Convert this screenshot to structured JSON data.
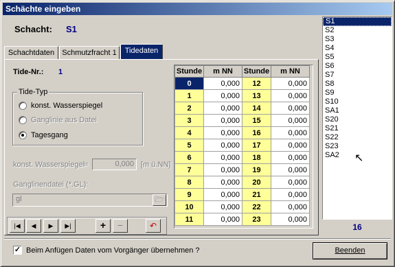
{
  "window": {
    "title": "Schächte eingeben"
  },
  "header": {
    "schacht_label": "Schacht:",
    "schacht_value": "S1"
  },
  "tabs": [
    {
      "label": "Schachtdaten",
      "active": false
    },
    {
      "label": "Schmutzfracht 1",
      "active": false
    },
    {
      "label": "Tidedaten",
      "active": true
    }
  ],
  "tide": {
    "nr_label": "Tide-Nr.:",
    "nr_value": "1",
    "type_group_title": "Tide-Typ",
    "options": [
      {
        "label": "konst. Wasserspiegel",
        "checked": false,
        "enabled": true
      },
      {
        "label": "Ganglinie aus Datei",
        "checked": false,
        "enabled": false
      },
      {
        "label": "Tagesgang",
        "checked": true,
        "enabled": true
      }
    ],
    "konst_label": "konst. Wasserspiegel",
    "konst_eq": "=",
    "konst_value": "0,000",
    "konst_unit": "[m ü.NN]",
    "gl_label": "Ganglinendatei (*.GL):",
    "gl_value": "gl"
  },
  "grid": {
    "columns": [
      "Stunde",
      "m NN",
      "Stunde",
      "m NN"
    ],
    "rows": [
      {
        "h1": "0",
        "v1": "0,000",
        "h2": "12",
        "v2": "0,000"
      },
      {
        "h1": "1",
        "v1": "0,000",
        "h2": "13",
        "v2": "0,000"
      },
      {
        "h1": "2",
        "v1": "0,000",
        "h2": "14",
        "v2": "0,000"
      },
      {
        "h1": "3",
        "v1": "0,000",
        "h2": "15",
        "v2": "0,000"
      },
      {
        "h1": "4",
        "v1": "0,000",
        "h2": "16",
        "v2": "0,000"
      },
      {
        "h1": "5",
        "v1": "0,000",
        "h2": "17",
        "v2": "0,000"
      },
      {
        "h1": "6",
        "v1": "0,000",
        "h2": "18",
        "v2": "0,000"
      },
      {
        "h1": "7",
        "v1": "0,000",
        "h2": "19",
        "v2": "0,000"
      },
      {
        "h1": "8",
        "v1": "0,000",
        "h2": "20",
        "v2": "0,000"
      },
      {
        "h1": "9",
        "v1": "0,000",
        "h2": "21",
        "v2": "0,000"
      },
      {
        "h1": "10",
        "v1": "0,000",
        "h2": "22",
        "v2": "0,000"
      },
      {
        "h1": "11",
        "v1": "0,000",
        "h2": "23",
        "v2": "0,000"
      }
    ]
  },
  "shafts": {
    "items": [
      "S1",
      "S2",
      "S3",
      "S4",
      "S5",
      "S6",
      "S7",
      "S8",
      "S9",
      "S10",
      "SA1",
      "S20",
      "S21",
      "S22",
      "S23",
      "SA2"
    ],
    "selected": "S1",
    "count": "16"
  },
  "footer": {
    "checkbox_label": "Beim Anfügen Daten vom Vorgänger übernehmen ?",
    "checkbox_checked": true,
    "check_mark": "✓",
    "close_button": "Beenden"
  },
  "icons": {
    "first": "first-record-icon",
    "prev": "prev-record-icon",
    "next": "next-record-icon",
    "last": "last-record-icon",
    "add": "add-icon",
    "remove": "remove-icon",
    "undo": "undo-icon",
    "folder": "folder-open-icon"
  }
}
